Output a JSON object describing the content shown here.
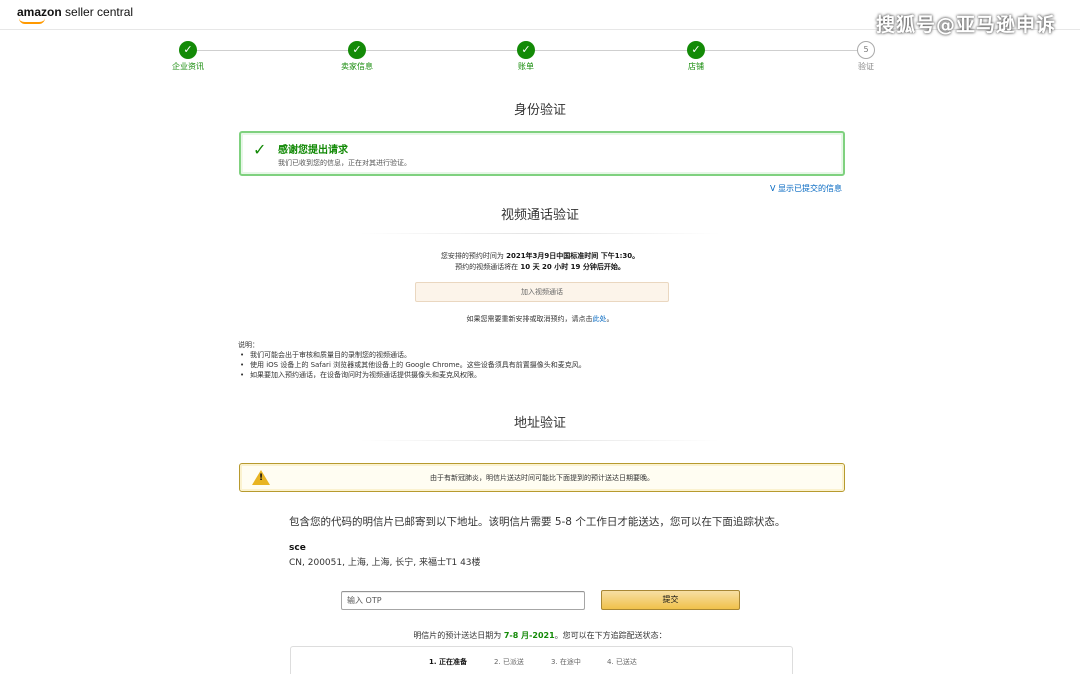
{
  "header": {
    "logo_amazon": "amazon",
    "logo_rest": " seller central",
    "watermark": "搜狐号@亚马逊申诉"
  },
  "steps": [
    {
      "label": "企业资讯",
      "state": "done"
    },
    {
      "label": "卖家信息",
      "state": "done"
    },
    {
      "label": "账单",
      "state": "done"
    },
    {
      "label": "店铺",
      "state": "done"
    },
    {
      "label": "验证",
      "state": "current",
      "number": "5"
    }
  ],
  "identity": {
    "title": "身份验证",
    "success_title": "感谢您提出请求",
    "success_sub": "我们已收到您的信息，正在对其进行验证。",
    "show_link": "V 显示已提交的信息"
  },
  "video": {
    "title": "视频通话验证",
    "line1_prefix": "您安排的预约时间为 ",
    "line1_time": "2021年3月9日中国标准时间 下午1:30。",
    "line2_prefix": "预约的视频通话将在 ",
    "line2_countdown": "10 天 20 小时 19 分钟后开始。",
    "join_button": "加入视频通话",
    "reschedule_prefix": "如果您需要重新安排或取消预约，请点击",
    "reschedule_link": "此处",
    "reschedule_suffix": "。",
    "notes_title": "说明：",
    "notes": [
      "我们可能会出于审核和质量目的录制您的视频通话。",
      "使用 iOS 设备上的 Safari 浏览器或其他设备上的 Google Chrome。这些设备须具有前置摄像头和麦克风。",
      "如果要加入预约通话，在设备询问时为视频通话提供摄像头和麦克风权限。"
    ]
  },
  "address": {
    "title": "地址验证",
    "warning": "由于有新冠肺炎，明信片送达时间可能比下面提到的预计送达日期要晚。",
    "description": "包含您的代码的明信片已邮寄到以下地址。该明信片需要 5-8 个工作日才能送达，您可以在下面追踪状态。",
    "name": "sce",
    "line": "CN, 200051, 上海, 上海, 长宁, 来福士T1 43楼",
    "otp_placeholder": "输入 OTP",
    "submit_label": "提交",
    "eta_prefix": "明信片的预计送达日期为 ",
    "eta_date": "7-8 月-2021",
    "eta_suffix": "。您可以在下方追踪配送状态：",
    "tracking": [
      {
        "label": "1. 正在准备",
        "active": true
      },
      {
        "label": "2. 已派送",
        "active": false
      },
      {
        "label": "3. 在途中",
        "active": false
      },
      {
        "label": "4. 已送达",
        "active": false
      }
    ]
  },
  "colors": {
    "success_green": "#138a07",
    "link_blue": "#0066c0",
    "button_yellow": "#f0c14b",
    "warning_yellow": "#e8b423"
  }
}
